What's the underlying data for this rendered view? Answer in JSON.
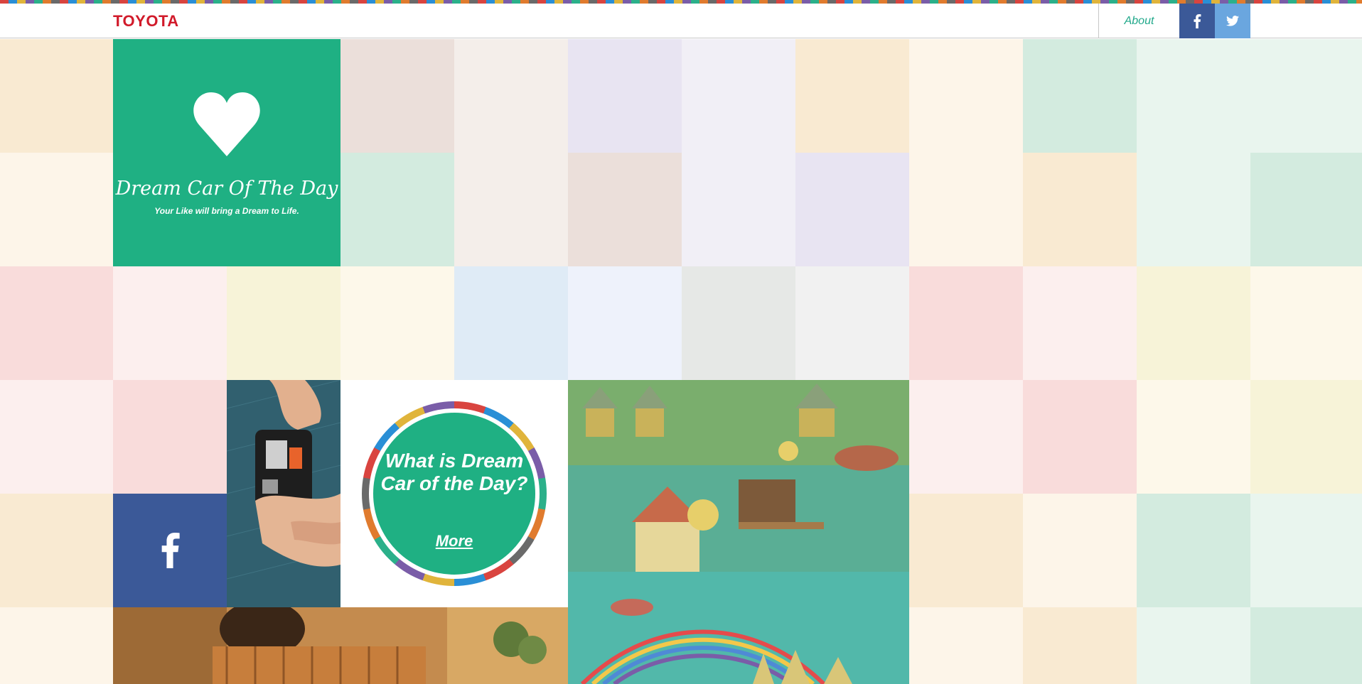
{
  "header": {
    "brand": "TOYOTA",
    "about_label": "About",
    "facebook_icon": "facebook-icon",
    "twitter_icon": "twitter-icon"
  },
  "hero": {
    "icon": "heart-icon",
    "title": "Dream Car Of The Day",
    "subtitle": "Your Like will bring a Dream to Life."
  },
  "what_is": {
    "question": "What is Dream Car of the Day?",
    "more_label": "More"
  },
  "social_tile": {
    "icon": "facebook-icon"
  },
  "colors": {
    "brand_red": "#d11a2a",
    "accent_green": "#1fb083",
    "facebook_blue": "#3b5998",
    "twitter_blue": "#6aa6df"
  }
}
